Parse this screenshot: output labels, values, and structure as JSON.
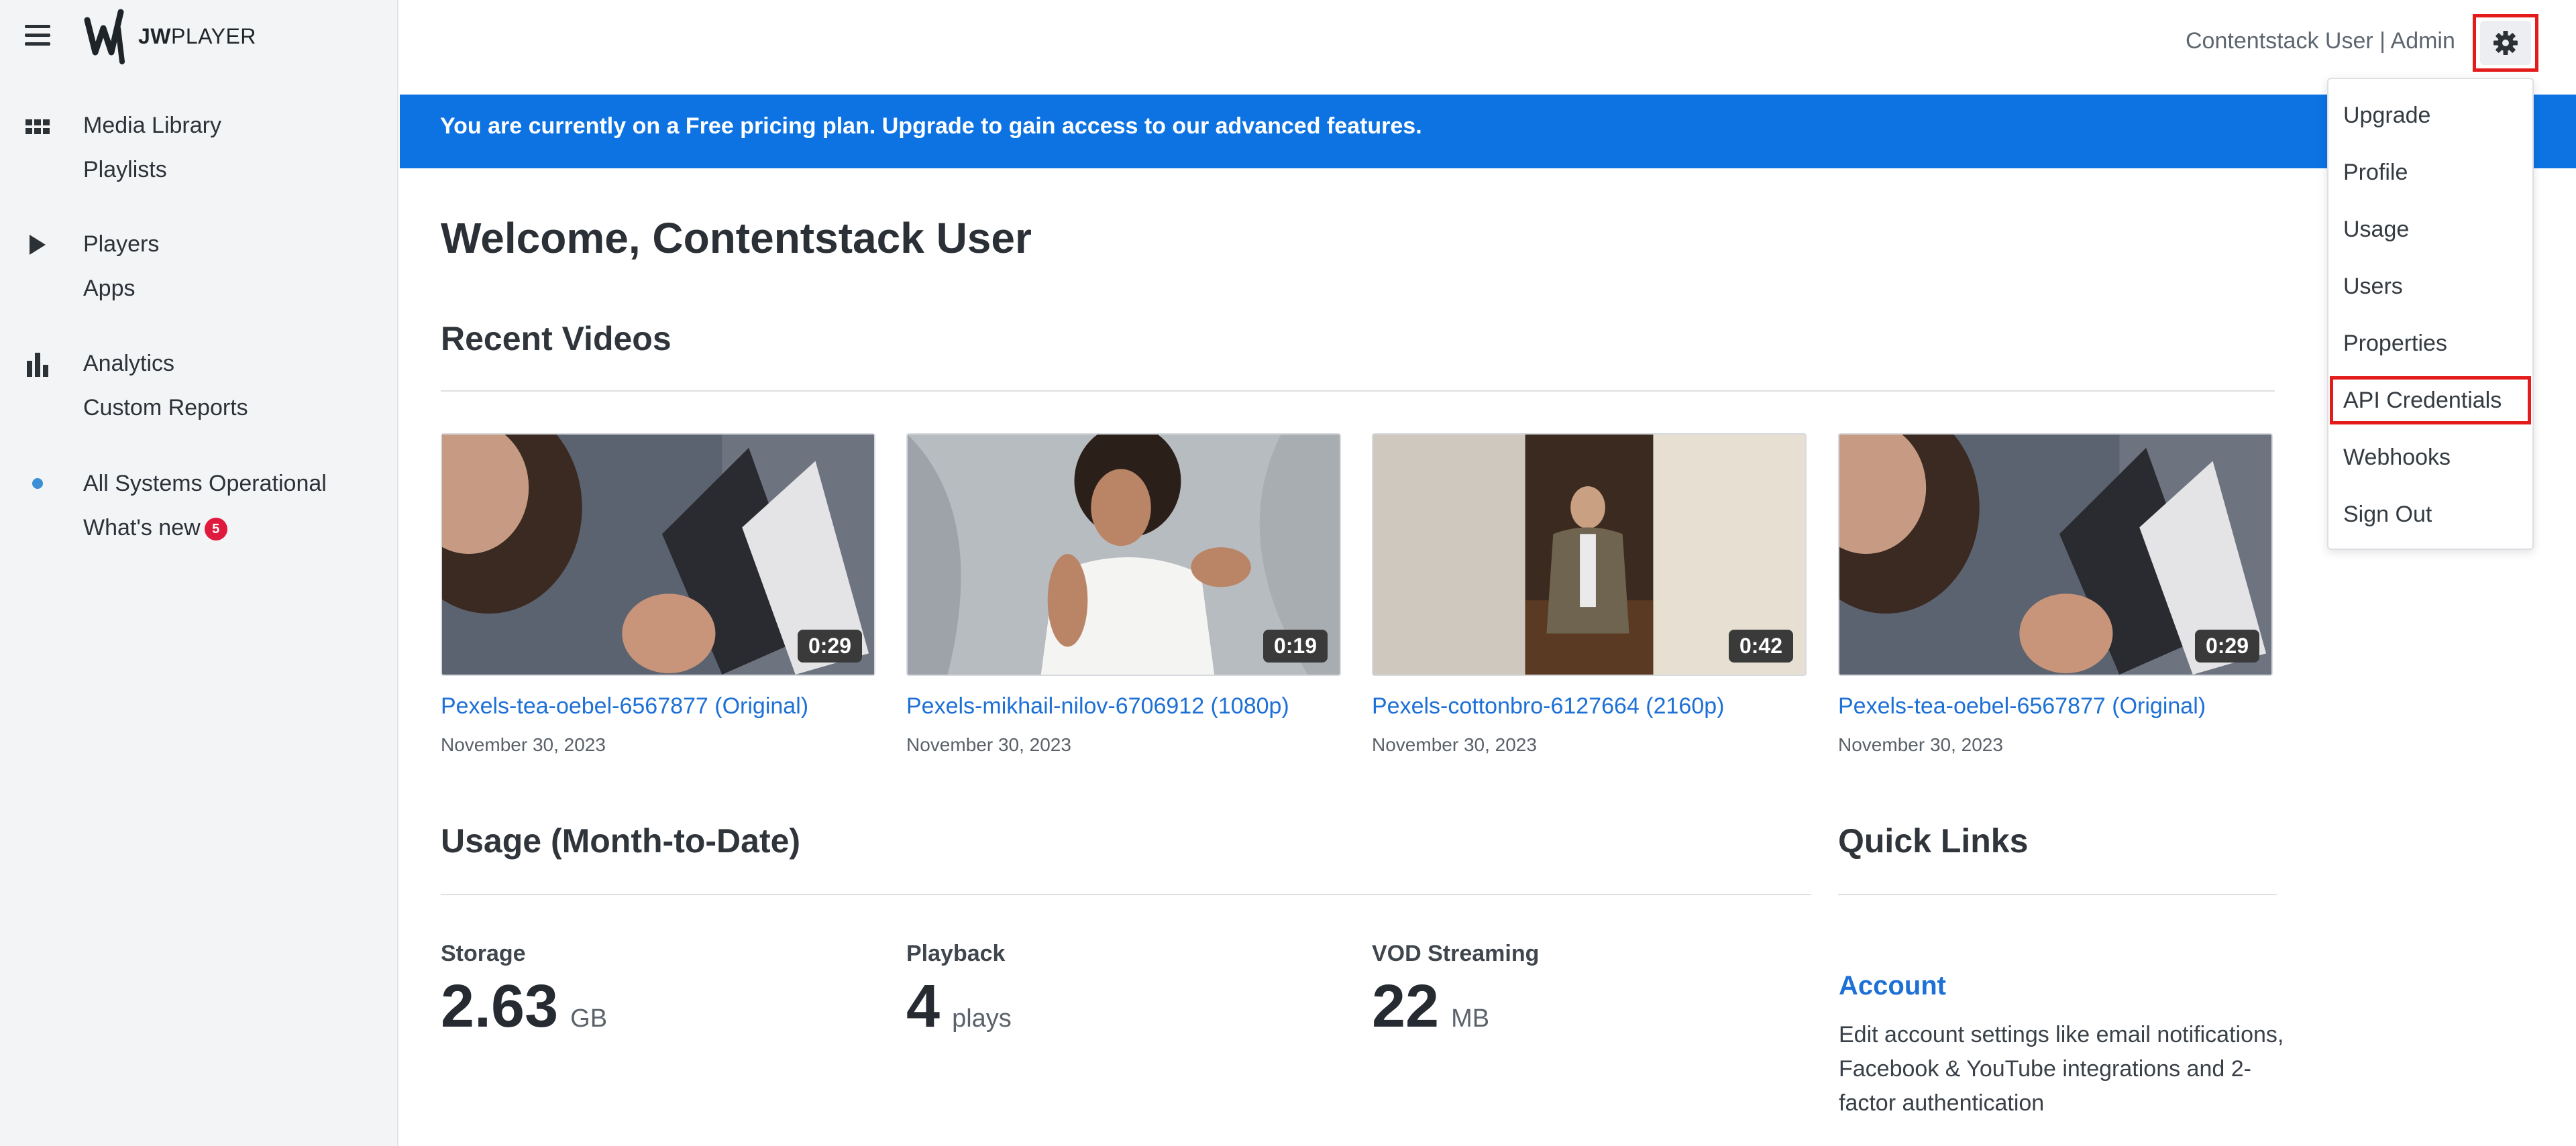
{
  "sidebar": {
    "logo_bold": "JW",
    "logo_light": "PLAYER",
    "items": [
      {
        "label": "Media Library"
      },
      {
        "label": "Playlists"
      },
      {
        "label": "Players"
      },
      {
        "label": "Apps"
      },
      {
        "label": "Analytics"
      },
      {
        "label": "Custom Reports"
      },
      {
        "label": "All Systems Operational"
      },
      {
        "label": "What's new",
        "badge": "5"
      }
    ],
    "icons": [
      "grid-icon",
      "play-icon",
      "bar-chart-icon",
      "status-dot-icon"
    ]
  },
  "header": {
    "user_label": "Contentstack User | Admin",
    "gear_icon": "gear-icon"
  },
  "banner": {
    "text": "You are currently on a Free pricing plan. Upgrade to gain access to our advanced features."
  },
  "main": {
    "welcome": "Welcome, Contentstack User",
    "recent_videos_title": "Recent Videos",
    "videos": [
      {
        "title": "Pexels-tea-oebel-6567877 (Original)",
        "date": "November 30, 2023",
        "duration": "0:29"
      },
      {
        "title": "Pexels-mikhail-nilov-6706912 (1080p)",
        "date": "November 30, 2023",
        "duration": "0:19"
      },
      {
        "title": "Pexels-cottonbro-6127664 (2160p)",
        "date": "November 30, 2023",
        "duration": "0:42"
      },
      {
        "title": "Pexels-tea-oebel-6567877 (Original)",
        "date": "November 30, 2023",
        "duration": "0:29"
      }
    ],
    "usage_title": "Usage (Month-to-Date)",
    "usage": [
      {
        "label": "Storage",
        "value": "2.63",
        "unit": "GB"
      },
      {
        "label": "Playback",
        "value": "4",
        "unit": "plays"
      },
      {
        "label": "VOD Streaming",
        "value": "22",
        "unit": "MB"
      }
    ],
    "quick_links_title": "Quick Links",
    "quick_links": [
      {
        "title": "Account",
        "description": "Edit account settings like email notifications, Facebook & YouTube integrations and 2-factor authentication"
      }
    ]
  },
  "dropdown": {
    "items": [
      "Upgrade",
      "Profile",
      "Usage",
      "Users",
      "Properties",
      "API Credentials",
      "Webhooks",
      "Sign Out"
    ],
    "highlighted": "API Credentials"
  },
  "colors": {
    "banner": "#0d73e3",
    "link": "#1d70d6",
    "highlight_box": "#e31b1b",
    "badge": "#e0193f",
    "status_dot": "#3b8fd6"
  }
}
